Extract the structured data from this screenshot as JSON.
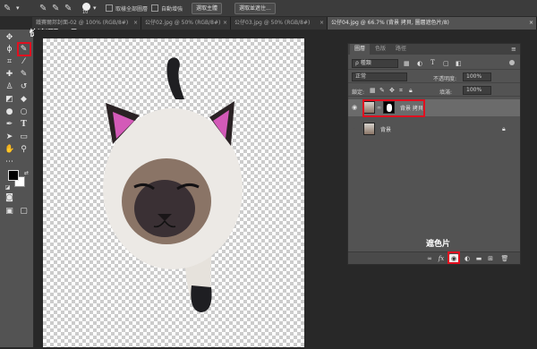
{
  "options_bar": {
    "brush_size": "10",
    "sample_all_layers_label": "取樣全部圖層",
    "auto_enhance_label": "自動增強",
    "select_subject_label": "選取主體",
    "select_and_mask_label": "選取並遮住..."
  },
  "tabs": [
    {
      "label": "鐵賽爾邦封面-02 @ 100% (RGB/8#)",
      "close": "×"
    },
    {
      "label": "公仔02.jpg @ 50% (RGB/8#)",
      "close": "×"
    },
    {
      "label": "公仔03.jpg @ 50% (RGB/8#)",
      "close": "×"
    },
    {
      "label": "公仔04.jpg @ 66.7% (背景 拷貝, 圖層遮色片/8)",
      "close": "×"
    }
  ],
  "annotations": {
    "quick_selection_tool": "快速選取工具",
    "layer_mask": "遮色片"
  },
  "layers_panel": {
    "tabs": [
      "圖層",
      "色版",
      "路徑"
    ],
    "filter_label": "ρ 種類",
    "blend_mode": "正常",
    "opacity_label": "不透明度:",
    "opacity_value": "100%",
    "lock_label": "鎖定:",
    "fill_label": "填滿:",
    "fill_value": "100%",
    "layers": [
      {
        "name": "背景 拷貝",
        "visible": true,
        "selected": true,
        "has_mask": true
      },
      {
        "name": "背景",
        "visible": false,
        "selected": false,
        "locked": true
      }
    ],
    "footer_icons": [
      "link-icon",
      "fx-icon",
      "add-mask-icon",
      "adjustment-icon",
      "group-icon",
      "new-layer-icon",
      "trash-icon"
    ],
    "fx_label": "fx"
  },
  "colors": {
    "annotation_red": "#e01020",
    "panel_bg": "#535353",
    "app_bg": "#282828"
  }
}
